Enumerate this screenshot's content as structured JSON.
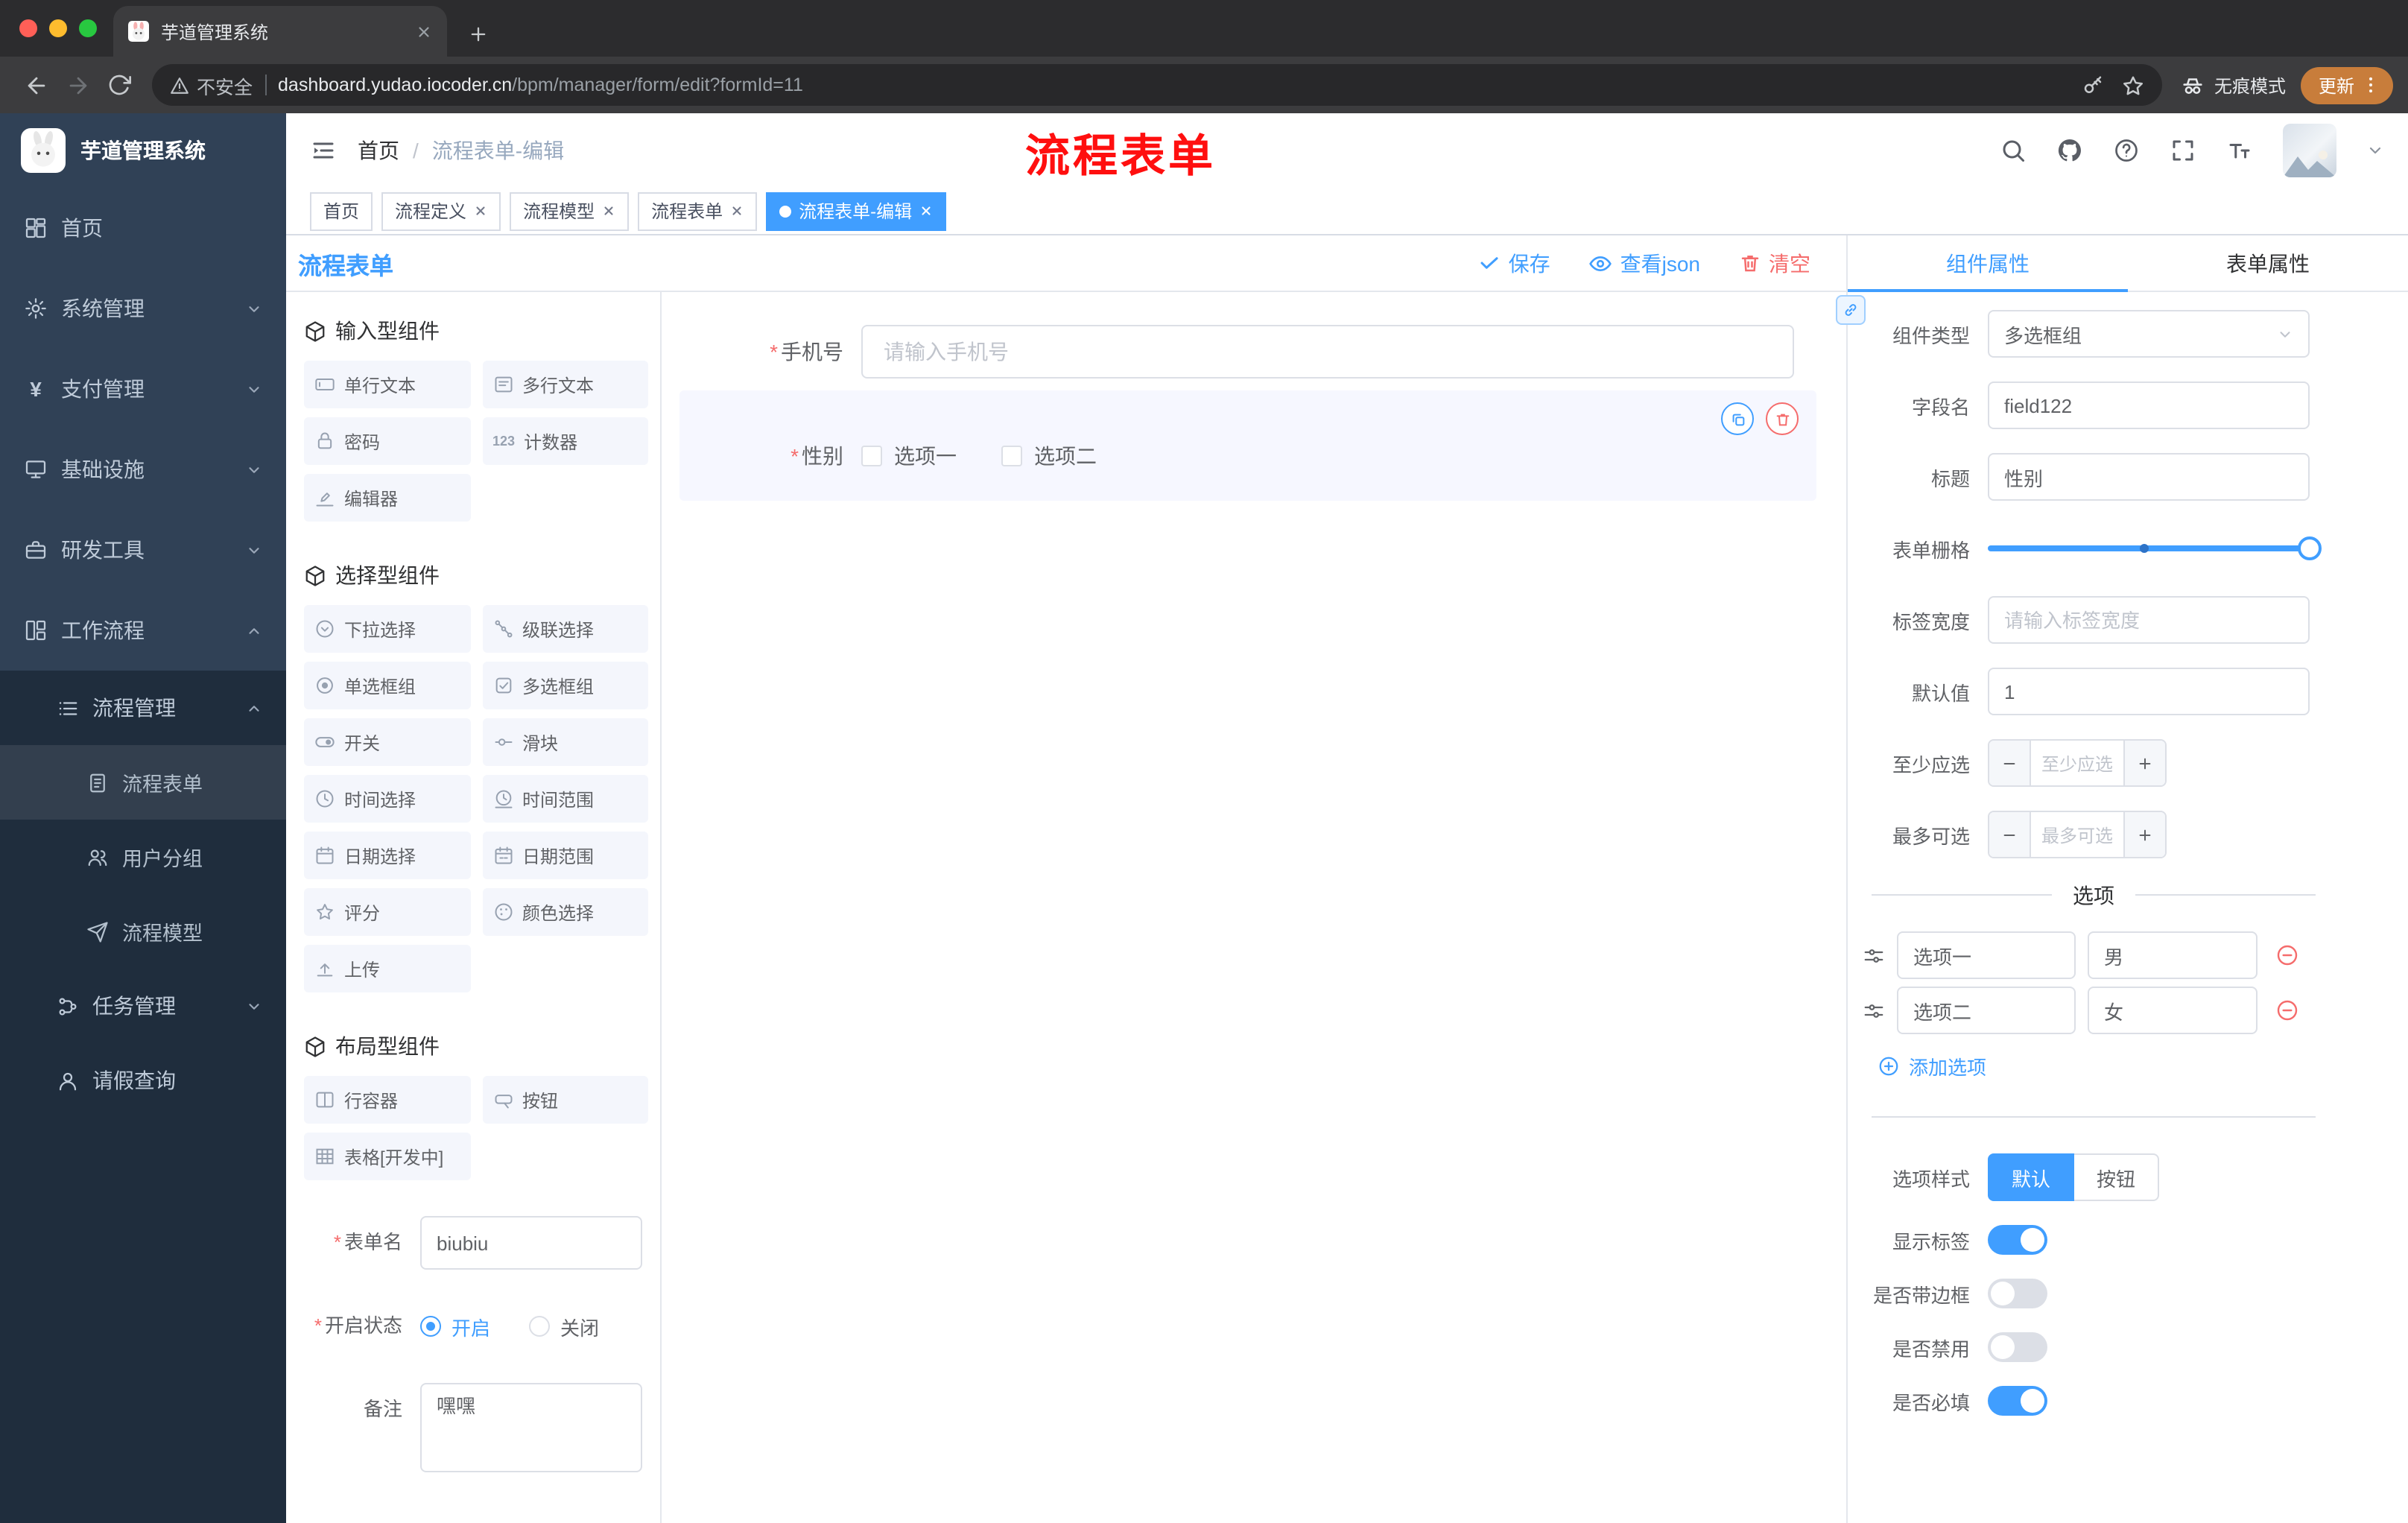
{
  "browser": {
    "tab_title": "芋道管理系统",
    "security_label": "不安全",
    "url_host": "dashboard.yudao.iocoder.cn",
    "url_path": "/bpm/manager/form/edit?formId=11",
    "incognito_label": "无痕模式",
    "update_label": "更新"
  },
  "sidebar": {
    "logo_title": "芋道管理系统",
    "menu": [
      {
        "label": "首页"
      },
      {
        "label": "系统管理"
      },
      {
        "label": "支付管理"
      },
      {
        "label": "基础设施"
      },
      {
        "label": "研发工具"
      },
      {
        "label": "工作流程"
      }
    ],
    "submenu": {
      "process_management": "流程管理",
      "process_form": "流程表单",
      "user_group": "用户分组",
      "process_model": "流程模型",
      "task_management": "任务管理",
      "leave_query": "请假查询"
    },
    "yen_icon_char": "¥"
  },
  "header": {
    "breadcrumb_home": "首页",
    "breadcrumb_current": "流程表单-编辑",
    "annotation": "流程表单"
  },
  "tags": [
    {
      "label": "首页"
    },
    {
      "label": "流程定义"
    },
    {
      "label": "流程模型"
    },
    {
      "label": "流程表单"
    },
    {
      "label": "流程表单-编辑"
    }
  ],
  "builder": {
    "title": "流程表单",
    "actions": {
      "save": "保存",
      "view_json": "查看json",
      "clear": "清空"
    },
    "palette": {
      "input_section": "输入型组件",
      "input_items": [
        "单行文本",
        "多行文本",
        "密码",
        "计数器",
        "编辑器"
      ],
      "select_section": "选择型组件",
      "select_items": [
        "下拉选择",
        "级联选择",
        "单选框组",
        "多选框组",
        "开关",
        "滑块",
        "时间选择",
        "时间范围",
        "日期选择",
        "日期范围",
        "评分",
        "颜色选择",
        "上传"
      ],
      "layout_section": "布局型组件",
      "layout_items": [
        "行容器",
        "按钮",
        "表格[开发中]"
      ],
      "counter_icon": "123"
    },
    "meta": {
      "form_name_label": "表单名",
      "form_name_value": "biubiu",
      "status_label": "开启状态",
      "status_on": "开启",
      "status_off": "关闭",
      "remark_label": "备注",
      "remark_value": "嘿嘿"
    },
    "canvas": {
      "phone_label": "手机号",
      "phone_placeholder": "请输入手机号",
      "gender_label": "性别",
      "gender_opt1": "选项一",
      "gender_opt2": "选项二"
    }
  },
  "props": {
    "tab_component": "组件属性",
    "tab_form": "表单属性",
    "component_type_label": "组件类型",
    "component_type_value": "多选框组",
    "field_name_label": "字段名",
    "field_name_value": "field122",
    "title_label": "标题",
    "title_value": "性别",
    "grid_label": "表单栅格",
    "label_width_label": "标签宽度",
    "label_width_placeholder": "请输入标签宽度",
    "default_label": "默认值",
    "default_value": "1",
    "min_label": "至少应选",
    "min_placeholder": "至少应选",
    "max_label": "最多可选",
    "max_placeholder": "最多可选",
    "options_divider": "选项",
    "option_rows": [
      {
        "label": "选项一",
        "value": "男"
      },
      {
        "label": "选项二",
        "value": "女"
      }
    ],
    "add_option": "添加选项",
    "option_style_label": "选项样式",
    "style_default": "默认",
    "style_button": "按钮",
    "toggle_show_label": "显示标签",
    "toggle_border": "是否带边框",
    "toggle_disabled": "是否禁用",
    "toggle_required": "是否必填"
  },
  "colors": {
    "primary": "#409eff",
    "danger": "#f56c6c",
    "annotation_red": "#ff0f0f",
    "sidebar_bg": "#304156",
    "submenu_bg": "#1f2d3d"
  }
}
